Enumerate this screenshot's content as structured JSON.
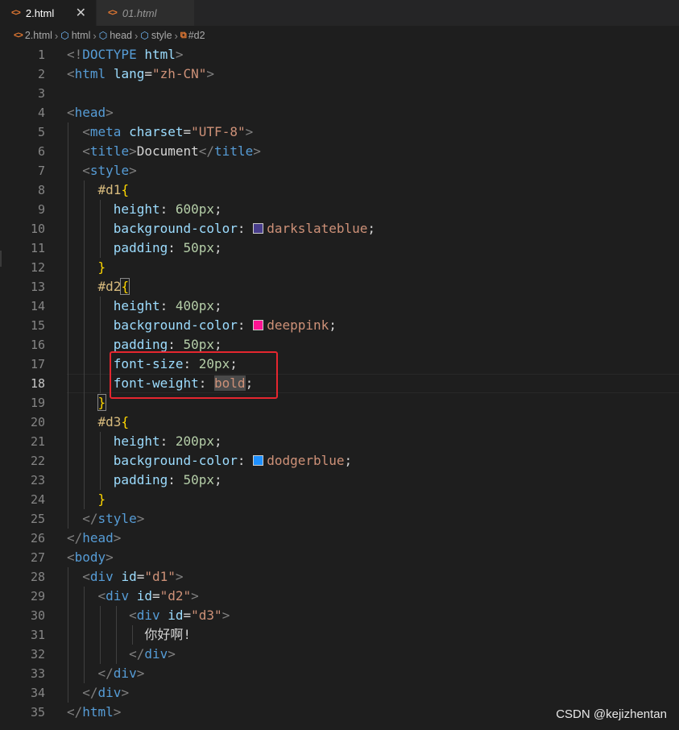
{
  "tabs": [
    {
      "icon": "<>",
      "label": "2.html",
      "active": true,
      "close": "✕"
    },
    {
      "icon": "<>",
      "label": "01.html",
      "active": false
    }
  ],
  "breadcrumb": [
    {
      "label": "2.html",
      "icon": "html-file-icon"
    },
    {
      "label": "html",
      "icon": "element-icon"
    },
    {
      "label": "head",
      "icon": "element-icon"
    },
    {
      "label": "style",
      "icon": "element-icon"
    },
    {
      "label": "#d2",
      "icon": "selector-icon"
    }
  ],
  "current_line": 18,
  "colors": {
    "darkslateblue": "#483d8b",
    "deeppink": "#ff1493",
    "dodgerblue": "#1e90ff",
    "highlight_box": "#e5262f"
  },
  "watermark": "CSDN @kejizhentan"
}
